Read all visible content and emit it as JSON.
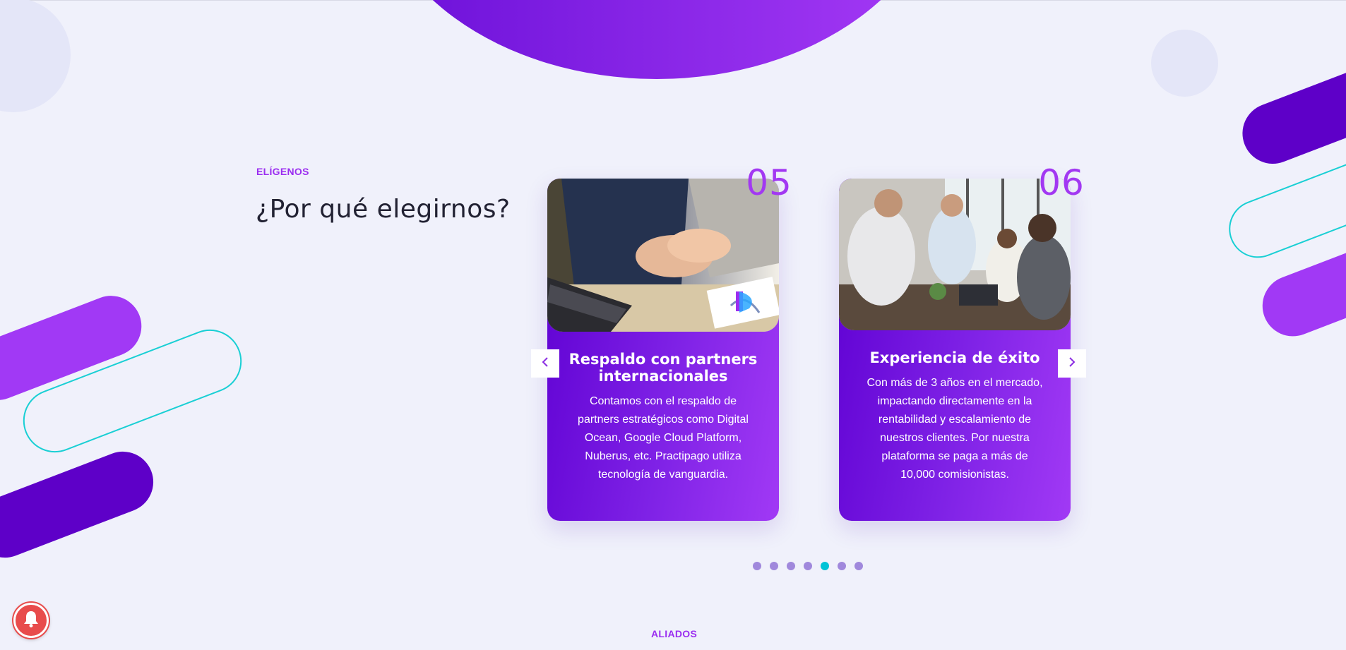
{
  "section": {
    "eyebrow": "ELÍGENOS",
    "title": "¿Por qué elegirnos?"
  },
  "cards": [
    {
      "number": "05",
      "title": "Respaldo con partners internacionales",
      "text": "Contamos con el respaldo de partners estratégicos como Digital Ocean, Google Cloud Platform, Nuberus, etc. Practipago utiliza tecnología de vanguardia.",
      "image": "handshake-laptop-photo"
    },
    {
      "number": "06",
      "title": "Experiencia de éxito",
      "text": "Con más de 3 años en el mercado, impactando directamente en la rentabilidad y escalamiento de nuestros clientes. Por nuestra plataforma se paga a más de 10,000 comisionistas.",
      "image": "office-team-handshake-photo"
    }
  ],
  "carousel": {
    "prev_icon": "chevron-left-icon",
    "next_icon": "chevron-right-icon",
    "dot_count": 7,
    "active_dot": 5
  },
  "footer": {
    "next_section_label": "ALIADOS"
  },
  "colors": {
    "background": "#f0f1fb",
    "purple_dark": "#5e00d2",
    "purple_light": "#a139f5",
    "accent_cyan": "#00c3d6",
    "eyebrow": "#9b2ef0",
    "notification": "#e84c4c"
  },
  "icons": {
    "notification": "bell-icon",
    "brand_mark": "practipago-logo-icon"
  }
}
